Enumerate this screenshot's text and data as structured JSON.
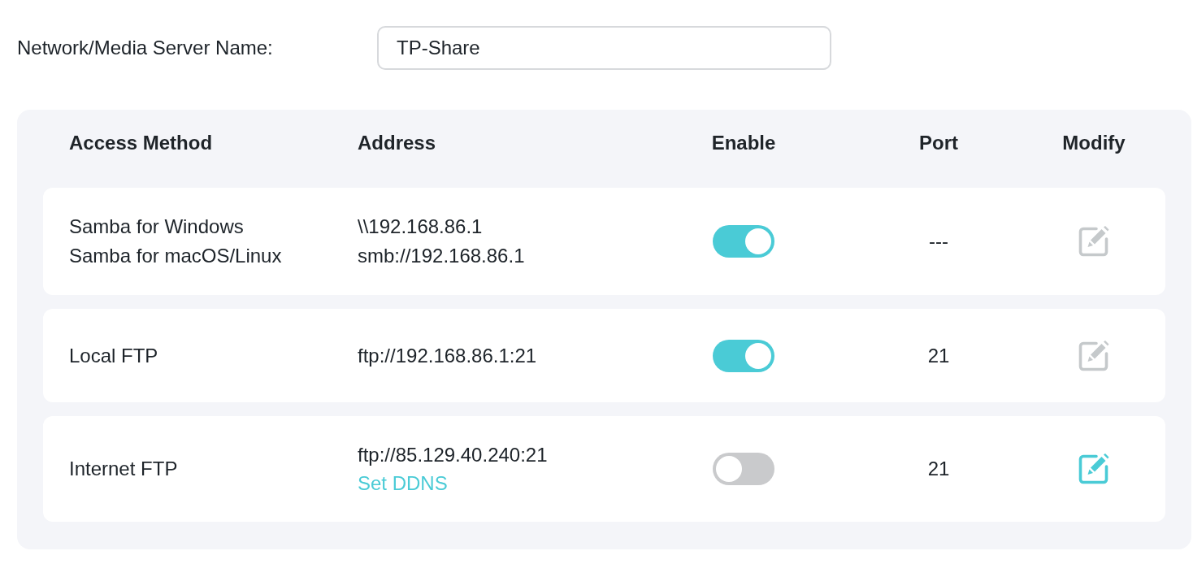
{
  "server_name": {
    "label": "Network/Media Server Name:",
    "value": "TP-Share"
  },
  "table": {
    "columns": [
      "Access Method",
      "Address",
      "Enable",
      "Port",
      "Modify"
    ],
    "rows": [
      {
        "methods": [
          "Samba for Windows",
          "Samba for macOS/Linux"
        ],
        "addresses": [
          "\\\\192.168.86.1",
          "smb://192.168.86.1"
        ],
        "enabled": true,
        "port": "---",
        "modify_disabled": true
      },
      {
        "methods": [
          "Local FTP"
        ],
        "addresses": [
          "ftp://192.168.86.1:21"
        ],
        "enabled": true,
        "port": "21",
        "modify_disabled": true
      },
      {
        "methods": [
          "Internet FTP"
        ],
        "addresses": [
          "ftp://85.129.40.240:21"
        ],
        "link": "Set DDNS",
        "enabled": false,
        "port": "21",
        "modify_disabled": false
      }
    ]
  }
}
